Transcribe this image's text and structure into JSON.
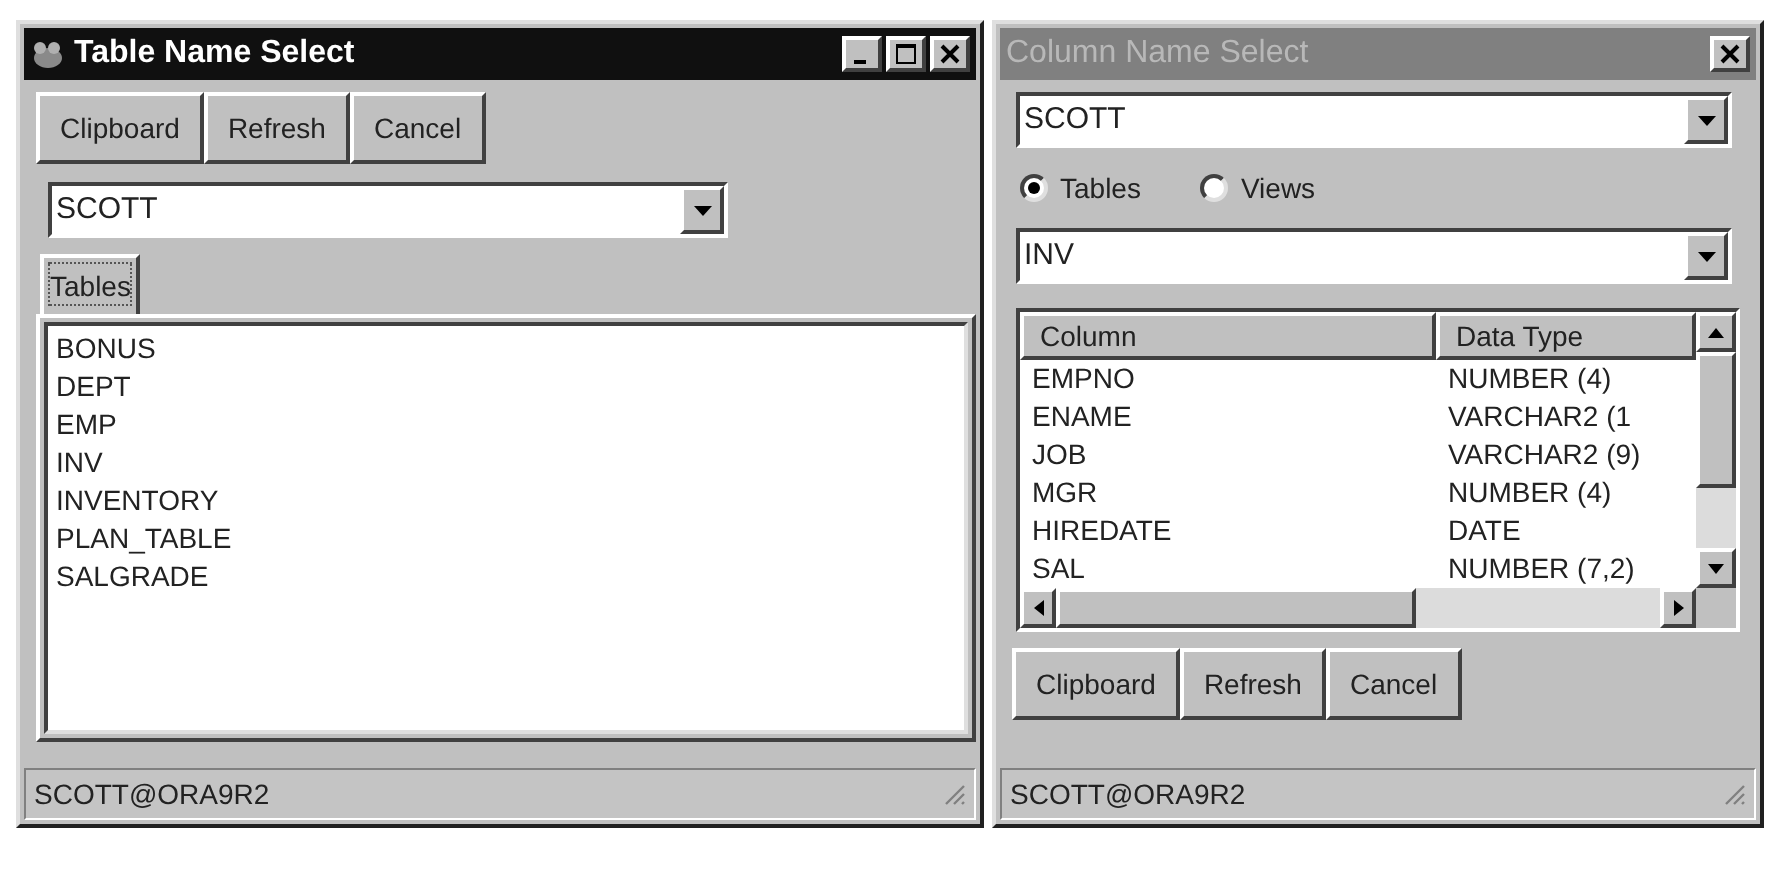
{
  "windows": [
    {
      "title": "Table Name Select",
      "active": true,
      "title_buttons": [
        {
          "kind": "minimize"
        },
        {
          "kind": "maximize"
        },
        {
          "kind": "close"
        }
      ],
      "buttons": [
        "Clipboard",
        "Refresh",
        "Cancel"
      ],
      "schema": {
        "value": "SCOTT"
      },
      "tabs": [
        {
          "label": "Tables",
          "selected": true
        }
      ],
      "list": [
        "BONUS",
        "DEPT",
        "EMP",
        "INV",
        "INVENTORY",
        "PLAN_TABLE",
        "SALGRADE"
      ],
      "status_bar": "SCOTT@ORA9R2"
    },
    {
      "title": "Column Name Select",
      "active": false,
      "title_buttons": [
        {
          "kind": "close"
        }
      ],
      "schema": {
        "value": "SCOTT"
      },
      "radios": [
        {
          "label": "Tables",
          "selected": true
        },
        {
          "label": "Views",
          "selected": false
        }
      ],
      "object": {
        "value": "INV"
      },
      "grid": {
        "columns": [
          "Column",
          "Data Type"
        ],
        "rows": [
          [
            "EMPNO",
            "NUMBER (4)"
          ],
          [
            "ENAME",
            "VARCHAR2 (1"
          ],
          [
            "JOB",
            "VARCHAR2 (9)"
          ],
          [
            "MGR",
            "NUMBER (4)"
          ],
          [
            "HIREDATE",
            "DATE"
          ],
          [
            "SAL",
            "NUMBER (7,2)"
          ]
        ]
      },
      "buttons": [
        "Clipboard",
        "Refresh",
        "Cancel"
      ],
      "status_bar": "SCOTT@ORA9R2"
    }
  ]
}
